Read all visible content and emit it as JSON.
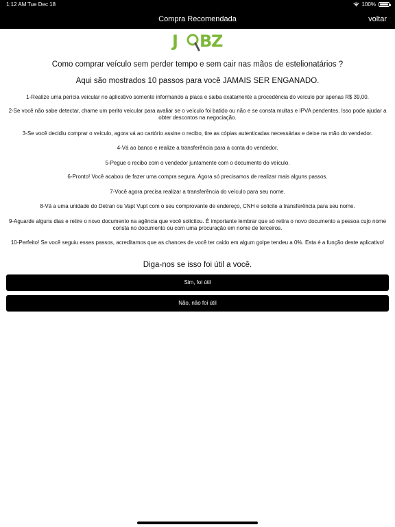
{
  "status_bar": {
    "time": "1:12 AM",
    "date": "Tue Dec 18",
    "battery": "100%",
    "icons": [
      "wifi-icon",
      "battery-icon"
    ]
  },
  "nav": {
    "title": "Compra Recomendada",
    "back_label": "voltar"
  },
  "logo": {
    "text": "JOBZ",
    "colors": {
      "primary": "#7db83a",
      "magnifier_handle": "#555555"
    }
  },
  "content": {
    "heading": "Como comprar veículo sem perder tempo e sem cair nas mãos de estelionatários ?",
    "subheading": "Aqui são mostrados 10 passos para você JAMAIS SER ENGANADO.",
    "steps": [
      "1-Realize uma perícia veicular no aplicativo somente informando a placa e saiba exatamente a procedência do veículo por apenas R$ 39,00.",
      "2-Se você não sabe detectar, chame um perito veicular para avaliar se o veículo foi batido ou não e se consta multas e IPVA pendentes. Isso pode ajudar a obter descontos na negociação.",
      "3-Se você decidiu comprar o veículo, agora vá ao cartório assine o recibo, tire as cópias autenticadas necessárias e deixe na mão do vendedor.",
      "4-Vá ao banco e realize a transferência para a conta do vendedor.",
      "5-Pegue o recibo com o vendedor juntamente com o documento do veículo.",
      "6-Pronto! Você acabou de fazer uma compra segura. Agora só precisamos de realizar mais alguns passos.",
      "7-Você agora precisa realizar a transferência do veículo para seu nome.",
      "8-Vá a uma unidade do Detran ou Vapt Vupt com o seu comprovante de endereço, CNH e solicite a transferência para seu nome.",
      "9-Aguarde alguns dias e retire o novo documento na agência que você solicitou. É importante lembrar que só retira o novo documento a pessoa cujo nome consta no documento ou com uma procuração em nome de terceiros.",
      "10-Perfeito! Se você seguiu esses passos, acreditamos que as chances de você ter caido em algum golpe tendeu a 0%. Esta é a função deste aplicativo!"
    ]
  },
  "feedback": {
    "question": "Diga-nos se isso foi útil a você.",
    "yes_label": "Sim, foi útil",
    "no_label": "Não, não foi útil"
  }
}
